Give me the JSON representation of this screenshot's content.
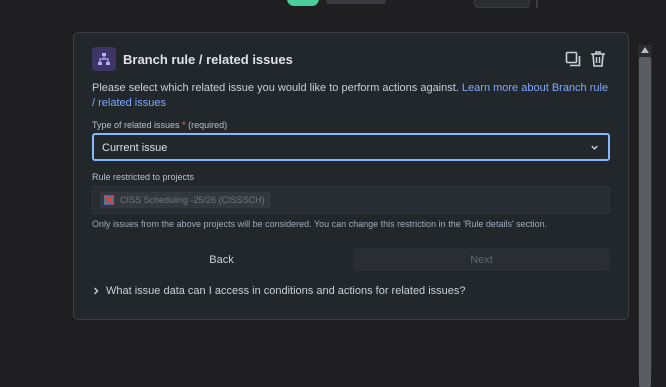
{
  "panel": {
    "title": "Branch rule / related issues",
    "description": "Please select which related issue you would like to perform actions against.",
    "learn_more_link": "Learn more about Branch rule / related issues",
    "type_label": "Type of related issues",
    "required_asterisk": "*",
    "required_text": "(required)",
    "selected_type": "Current issue",
    "projects_label": "Rule restricted to projects",
    "project_tag": "CISS Scheduling -25/26 (CISSSCH)",
    "help_text": "Only issues from the above projects will be considered. You can change this restriction in the 'Rule details' section.",
    "back_label": "Back",
    "next_label": "Next",
    "expander_label": "What issue data can I access in conditions and actions for related issues?"
  },
  "colors": {
    "accent": "#85b8ff",
    "link": "#7fa8ff",
    "required": "#f87168",
    "icon_bg": "#3d3566"
  }
}
